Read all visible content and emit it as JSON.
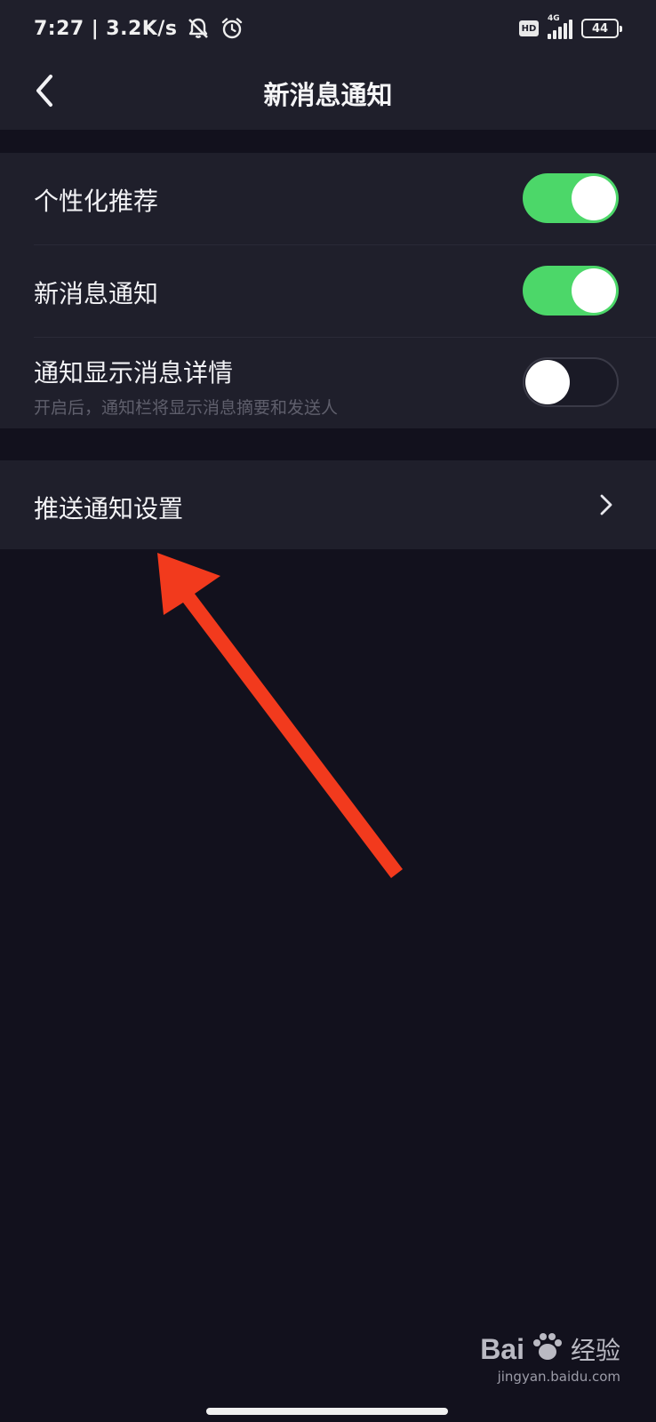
{
  "status_bar": {
    "time": "7:27",
    "separator": "|",
    "speed": "3.2K/s",
    "muted_icon": "bell-off-icon",
    "alarm_icon": "alarm-icon",
    "hd": "HD",
    "network": "4G",
    "battery": "44"
  },
  "header": {
    "back_icon": "chevron-left-icon",
    "title": "新消息通知"
  },
  "settings": {
    "personalized": {
      "label": "个性化推荐",
      "enabled": true
    },
    "new_message": {
      "label": "新消息通知",
      "enabled": true
    },
    "show_details": {
      "label": "通知显示消息详情",
      "sub": "开启后，通知栏将显示消息摘要和发送人",
      "enabled": false
    },
    "push_settings": {
      "label": "推送通知设置",
      "chevron_icon": "chevron-right-icon"
    }
  },
  "annotation": {
    "arrow_color": "#f23a1d"
  },
  "watermark": {
    "logo": "Bai",
    "suffix": "经验",
    "url": "jingyan.baidu.com"
  },
  "colors": {
    "toggle_on": "#4cd769",
    "background": "#12111d",
    "surface": "#1f1f2b"
  }
}
